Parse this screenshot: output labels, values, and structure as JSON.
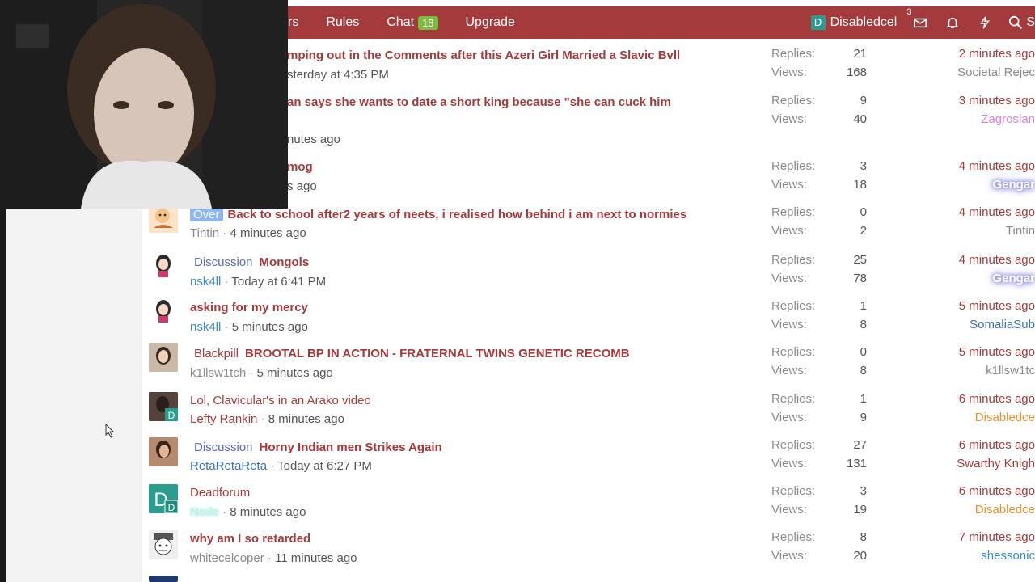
{
  "nav": {
    "items": [
      {
        "label": "rs"
      },
      {
        "label": "Rules"
      },
      {
        "label": "Chat",
        "badge": "18"
      },
      {
        "label": "Upgrade"
      }
    ],
    "username": "Disabledcel",
    "user_initial": "D",
    "inbox_count": "3",
    "search_label": "S"
  },
  "threads": [
    {
      "title": "mping out in the Comments after this Azeri Girl Married a Slavic Bvll",
      "author": "",
      "date": "sterday at 4:35 PM",
      "replies": "21",
      "views": "168",
      "latest_time": "2 minutes ago",
      "latest_user": "Societal Rejec"
    },
    {
      "title": "an says she wants to date a short king because \"she can cuck him",
      "author": "",
      "date": "nutes ago",
      "replies": "9",
      "views": "40",
      "latest_time": "3 minutes ago",
      "latest_user": "Zagrosian"
    },
    {
      "title": "mog",
      "author": "",
      "date": "s ago",
      "replies": "3",
      "views": "18",
      "latest_time": "4 minutes ago",
      "latest_user": "Gengar"
    },
    {
      "prefix": "Over",
      "title": "Back to school after2 years of neets, i realised how behind i am next to normies",
      "author": "Tintin",
      "date": "4 minutes ago",
      "replies": "0",
      "views": "2",
      "latest_time": "4 minutes ago",
      "latest_user": "Tintin"
    },
    {
      "prefix": "Discussion",
      "title": "Mongols",
      "author": "nsk4ll",
      "date": "Today at 6:41 PM",
      "replies": "25",
      "views": "78",
      "latest_time": "4 minutes ago",
      "latest_user": "Gengar"
    },
    {
      "title": "asking for my mercy",
      "author": "nsk4ll",
      "date": "5 minutes ago",
      "replies": "1",
      "views": "8",
      "latest_time": "5 minutes ago",
      "latest_user": "SomaliaSub"
    },
    {
      "prefix": "Blackpill",
      "title": "BROOTAL BP IN ACTION - FRATERNAL TWINS GENETIC RECOMB",
      "author": "k1llsw1tch",
      "date": "5 minutes ago",
      "replies": "0",
      "views": "8",
      "latest_time": "5 minutes ago",
      "latest_user": "k1llsw1tc"
    },
    {
      "title": "Lol, Clavicular's in an Arako video",
      "author": "Lefty Rankin",
      "date": "8 minutes ago",
      "replies": "1",
      "views": "9",
      "latest_time": "6 minutes ago",
      "latest_user": "Disabledce"
    },
    {
      "prefix": "Discussion",
      "title": "Horny Indian men Strikes Again",
      "author": "RetaRetaReta",
      "date": "Today at 6:27 PM",
      "replies": "27",
      "views": "131",
      "latest_time": "6 minutes ago",
      "latest_user": "Swarthy Knigh"
    },
    {
      "title": "Deadforum",
      "author": "Node",
      "date": "8 minutes ago",
      "replies": "3",
      "views": "19",
      "latest_time": "6 minutes ago",
      "latest_user": "Disabledce"
    },
    {
      "title": "why am I so retarded",
      "author": "whitecelcoper",
      "date": "11 minutes ago",
      "replies": "8",
      "views": "20",
      "latest_time": "7 minutes ago",
      "latest_user": "shessonic"
    }
  ],
  "labels": {
    "replies": "Replies:",
    "views": "Views:"
  },
  "colors": {
    "brand": "#a33a3c",
    "chat_badge": "#7dbb3c",
    "prefix_blue": "#5c6bc0",
    "muted": "#8a8a8a"
  }
}
